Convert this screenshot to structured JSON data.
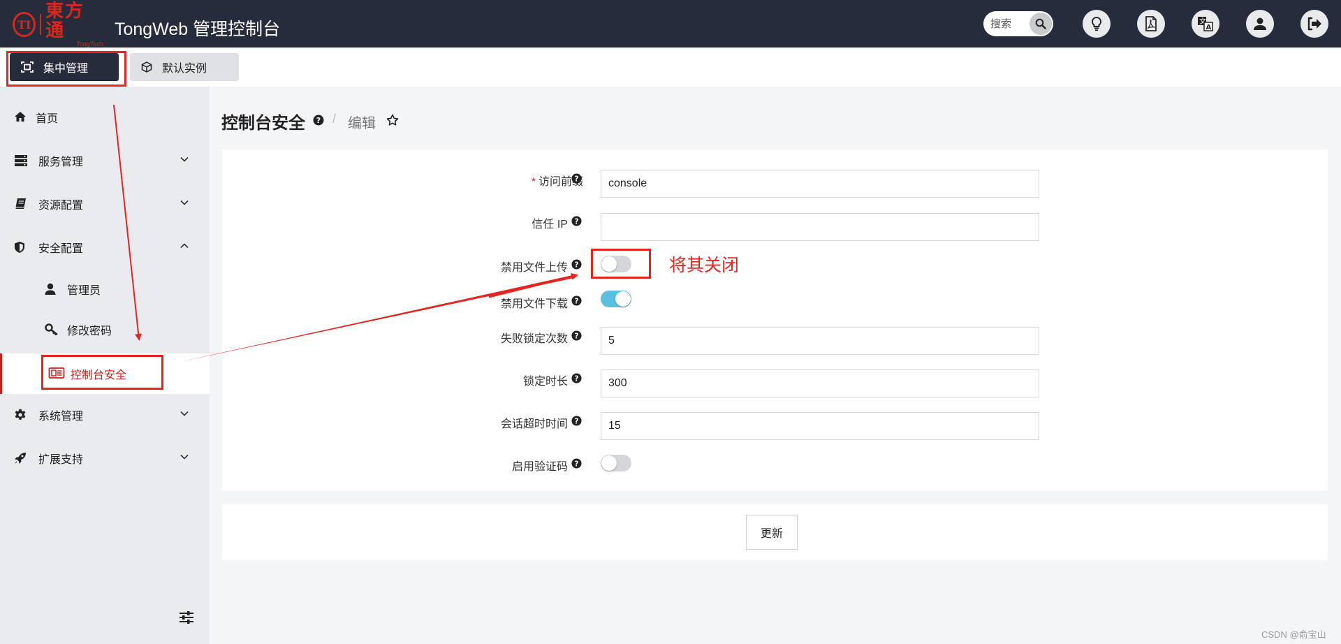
{
  "header": {
    "logo": {
      "mark": "TI",
      "cn": "東方通",
      "en": "TongTech"
    },
    "title": "TongWeb 管理控制台",
    "search": {
      "placeholder": "搜索"
    },
    "buttons": [
      "lightbulb-icon",
      "pdf-icon",
      "translate-icon",
      "user-icon",
      "logout-icon"
    ]
  },
  "tabs": [
    {
      "label": "集中管理",
      "icon": "central-manage-icon",
      "active": true
    },
    {
      "label": "默认实例",
      "icon": "cube-icon",
      "active": false
    }
  ],
  "sidebar": {
    "items": [
      {
        "label": "首页",
        "icon": "home-icon"
      },
      {
        "label": "服务管理",
        "icon": "server-icon",
        "chevron": "down"
      },
      {
        "label": "资源配置",
        "icon": "book-icon",
        "chevron": "down"
      },
      {
        "label": "安全配置",
        "icon": "shield-icon",
        "chevron": "up"
      },
      {
        "label": "管理员",
        "icon": "user-icon",
        "sub": true
      },
      {
        "label": "修改密码",
        "icon": "key-icon",
        "sub": true
      },
      {
        "label": "控制台安全",
        "icon": "console-icon",
        "sub": true,
        "active": true
      },
      {
        "label": "系统管理",
        "icon": "gear-icon",
        "chevron": "down"
      },
      {
        "label": "扩展支持",
        "icon": "rocket-icon",
        "chevron": "down"
      }
    ]
  },
  "page": {
    "title": "控制台安全",
    "separator": "/",
    "crumb": "编辑"
  },
  "form": {
    "fields": [
      {
        "label": "访问前缀",
        "required": "*",
        "type": "text",
        "value": "console"
      },
      {
        "label": "信任 IP",
        "type": "text",
        "value": ""
      },
      {
        "label": "禁用文件上传",
        "type": "toggle",
        "on": false
      },
      {
        "label": "禁用文件下载",
        "type": "toggle",
        "on": true
      },
      {
        "label": "失败锁定次数",
        "type": "text",
        "value": "5"
      },
      {
        "label": "锁定时长",
        "type": "text",
        "value": "300"
      },
      {
        "label": "会话超时时间",
        "type": "text",
        "value": "15"
      },
      {
        "label": "启用验证码",
        "type": "toggle",
        "on": false
      }
    ],
    "submit_label": "更新"
  },
  "annotation": {
    "text": "将其关闭",
    "color": "#e52620"
  },
  "watermark": "CSDN @俞宝山",
  "colors": {
    "header_bg": "#272c3d",
    "accent_red": "#c8201d",
    "toggle_on": "#5bbfe0"
  }
}
